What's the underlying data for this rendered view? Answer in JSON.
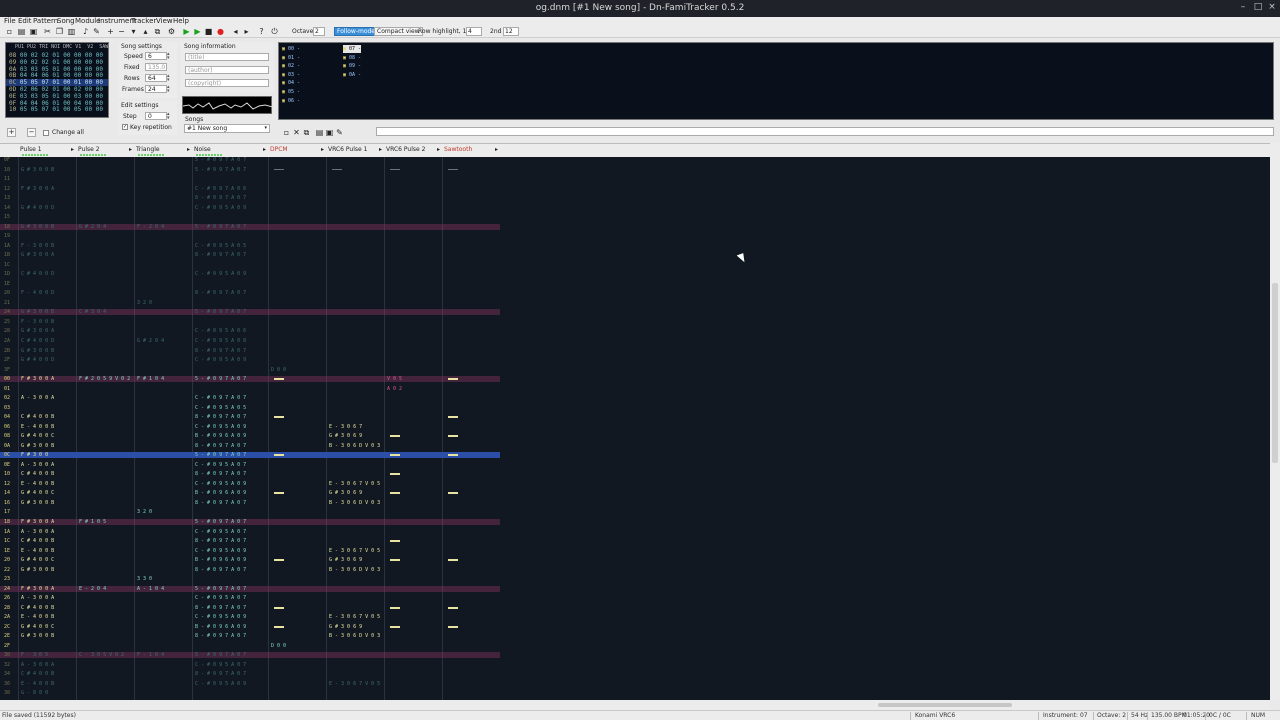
{
  "window": {
    "title": "og.dnm [#1 New song] - Dn-FamiTracker 0.5.2"
  },
  "menu": [
    "File",
    "Edit",
    "Pattern",
    "Song",
    "Module",
    "Instrument",
    "Tracker",
    "View",
    "Help"
  ],
  "toolbar": {
    "octave_label": "Octave",
    "octave_value": "2",
    "follow_mode": "Follow-mode",
    "compact_view": "Compact view",
    "row_highlight_label": "Row highlight, 1st",
    "row_highlight_1st": "4",
    "second_label": "2nd",
    "row_highlight_2nd": "12"
  },
  "frames": {
    "header": "PU1 PU2 TRI NOI DMC V1  V2  SAW",
    "rows": [
      {
        "n": "08",
        "v": "00 02 02 01 00 00 00 00"
      },
      {
        "n": "09",
        "v": "00 02 02 01 00 00 00 00"
      },
      {
        "n": "0A",
        "v": "03 03 05 01 00 00 00 00"
      },
      {
        "n": "0B",
        "v": "04 04 06 01 00 00 00 00"
      },
      {
        "n": "0C",
        "v": "05 05 07 01 00 01 00 00"
      },
      {
        "n": "0D",
        "v": "02 06 02 01 00 02 00 00"
      },
      {
        "n": "0E",
        "v": "03 03 05 01 00 03 00 00"
      },
      {
        "n": "0F",
        "v": "04 04 06 01 00 04 00 00"
      },
      {
        "n": "10",
        "v": "05 05 07 01 00 05 00 00"
      }
    ],
    "selected_index": 4,
    "change_all": "Change all"
  },
  "song_settings": {
    "title": "Song settings",
    "speed_label": "Speed",
    "speed": "6",
    "fixed_label": "Fixed",
    "fixed": "135.0",
    "rows_label": "Rows",
    "rows": "64",
    "frames_label": "Frames",
    "frames": "24"
  },
  "edit_settings": {
    "title": "Edit settings",
    "step_label": "Step",
    "step": "0",
    "key_repetition": "Key repetition"
  },
  "song_info": {
    "title": "Song information",
    "title_ph": "(title)",
    "author_ph": "(author)",
    "copyright_ph": "(copyright)",
    "songs_label": "Songs",
    "song_selected": "#1 New song"
  },
  "instruments": {
    "left": [
      "00 -",
      "01 -",
      "02 -",
      "03 -",
      "04 -",
      "05 -",
      "06 -"
    ],
    "right": [
      "07 -",
      "08 -",
      "09 -",
      "0A -"
    ],
    "selected": "07 -"
  },
  "channels": [
    {
      "name": "Pulse 1",
      "color": "#222222"
    },
    {
      "name": "Pulse 2",
      "color": "#222222"
    },
    {
      "name": "Triangle",
      "color": "#222222"
    },
    {
      "name": "Noise",
      "color": "#222222"
    },
    {
      "name": "DPCM",
      "color": "#c0392b"
    },
    {
      "name": "VRC6 Pulse 1",
      "color": "#222222"
    },
    {
      "name": "VRC6 Pulse 2",
      "color": "#222222"
    },
    {
      "name": "Sawtooth",
      "color": "#c0392b"
    }
  ],
  "pattern_rows": [
    {
      "r": "0F",
      "c": [
        "",
        "",
        "",
        "5 - # 0 9 7 A 0 7",
        "",
        "",
        "",
        ""
      ],
      "dim": true
    },
    {
      "r": "10",
      "c": [
        "G # 3 0 0 B",
        "",
        "",
        "5 - # 0 9 7 A 0 7",
        "-",
        "-",
        "-",
        "-"
      ],
      "dim": true
    },
    {
      "r": "11",
      "c": [
        "",
        "",
        "",
        "",
        "",
        "",
        "",
        ""
      ],
      "dim": true
    },
    {
      "r": "12",
      "c": [
        "F # 3 0 0 A",
        "",
        "",
        "C - # 0 9 7 A 0 6",
        "",
        "",
        "",
        ""
      ],
      "dim": true
    },
    {
      "r": "13",
      "c": [
        "",
        "",
        "",
        "8 - # 0 9 7 A 0 7",
        "",
        "",
        "",
        ""
      ],
      "dim": true
    },
    {
      "r": "14",
      "c": [
        "G # 4 0 0 D",
        "",
        "",
        "C - # 0 9 5 A 0 9",
        "",
        "",
        "",
        ""
      ],
      "dim": true
    },
    {
      "r": "15",
      "c": [
        "",
        "",
        "",
        "",
        "",
        "",
        "",
        ""
      ],
      "dim": true
    },
    {
      "r": "18",
      "c": [
        "G # 3 0 0 B",
        "G # 2 0 4",
        "F - 2 0 4",
        "5 - # 0 9 7 A 0 7",
        "",
        "",
        "",
        ""
      ],
      "dim": true,
      "hl": true
    },
    {
      "r": "19",
      "c": [
        "",
        "",
        "",
        "",
        "",
        "",
        "",
        ""
      ],
      "dim": true
    },
    {
      "r": "1A",
      "c": [
        "F - 3 0 0 B",
        "",
        "",
        "C - # 0 9 5 A 0 5",
        "",
        "",
        "",
        ""
      ],
      "dim": true
    },
    {
      "r": "1B",
      "c": [
        "G # 3 0 0 A",
        "",
        "",
        "8 - # 0 9 7 A 0 7",
        "",
        "",
        "",
        ""
      ],
      "dim": true
    },
    {
      "r": "1C",
      "c": [
        "",
        "",
        "",
        "",
        "",
        "",
        "",
        ""
      ],
      "dim": true
    },
    {
      "r": "1D",
      "c": [
        "C # 4 0 0 D",
        "",
        "",
        "C - # 0 9 5 A 0 9",
        "",
        "",
        "",
        ""
      ],
      "dim": true
    },
    {
      "r": "1E",
      "c": [
        "",
        "",
        "",
        "",
        "",
        "",
        "",
        ""
      ],
      "dim": true
    },
    {
      "r": "20",
      "c": [
        "F - 4 0 0 D",
        "",
        "",
        "8 - # 0 9 7 A 0 7",
        "",
        "",
        "",
        ""
      ],
      "dim": true
    },
    {
      "r": "21",
      "c": [
        "",
        "",
        "3 2 0",
        "",
        "",
        "",
        "",
        ""
      ],
      "dim": true
    },
    {
      "r": "24",
      "c": [
        "G # 3 0 0 B",
        "C # 3 0 4",
        "",
        "5 - # 0 9 7 A 0 7",
        "",
        "",
        "",
        ""
      ],
      "dim": true,
      "hl": true
    },
    {
      "r": "25",
      "c": [
        "F - 3 0 0 B",
        "",
        "",
        "",
        "",
        "",
        "",
        ""
      ],
      "dim": true
    },
    {
      "r": "28",
      "c": [
        "G # 3 0 0 A",
        "",
        "",
        "C - # 0 9 5 A 0 6",
        "",
        "",
        "",
        ""
      ],
      "dim": true
    },
    {
      "r": "2A",
      "c": [
        "C # 4 0 0 D",
        "",
        "G # 2 0 4",
        "C - # 0 9 5 A 0 8",
        "",
        "",
        "",
        ""
      ],
      "dim": true
    },
    {
      "r": "2B",
      "c": [
        "G # 3 0 0 B",
        "",
        "",
        "8 - # 0 9 7 A 0 7",
        "",
        "",
        "",
        ""
      ],
      "dim": true
    },
    {
      "r": "2F",
      "c": [
        "G # 4 0 0 D",
        "",
        "",
        "C - # 0 9 5 A 0 9",
        "",
        "",
        "",
        ""
      ],
      "dim": true
    },
    {
      "r": "3F",
      "c": [
        "",
        "",
        "",
        "",
        "D 0 0",
        "",
        "",
        ""
      ],
      "dim": true
    },
    {
      "r": "00",
      "c": [
        "F # 3 0 0 A",
        "F # 2 0 5 9 V 0 2",
        "F # 1 0 4",
        "5 - # 0 9 7 A 0 7",
        "-",
        "",
        "V 0 5",
        "-"
      ],
      "hl": true
    },
    {
      "r": "01",
      "c": [
        "",
        "",
        "",
        "",
        "",
        "",
        "A 0 2",
        ""
      ]
    },
    {
      "r": "02",
      "c": [
        "A - 3 0 0 A",
        "",
        "",
        "C - # 0 9 7 A 0 7",
        "",
        "",
        "",
        ""
      ]
    },
    {
      "r": "03",
      "c": [
        "",
        "",
        "",
        "C - # 0 9 5 A 0 5",
        "",
        "",
        "",
        ""
      ]
    },
    {
      "r": "04",
      "c": [
        "C # 4 0 0 B",
        "",
        "",
        "8 - # 0 9 7 A 0 7",
        "-",
        "",
        "",
        "-"
      ]
    },
    {
      "r": "06",
      "c": [
        "E - 4 0 0 B",
        "",
        "",
        "C - # 0 9 5 A 0 9",
        "",
        "E - 3 0 6 7",
        "",
        ""
      ]
    },
    {
      "r": "08",
      "c": [
        "G # 4 0 0 C",
        "",
        "",
        "B - # 0 9 6 A 0 9",
        "",
        "G # 3 0 6 9",
        "-",
        "-"
      ]
    },
    {
      "r": "0A",
      "c": [
        "G # 3 0 0 B",
        "",
        "",
        "8 - # 0 9 7 A 0 7",
        "",
        "B - 3 0 6 D V 0 3",
        "",
        ""
      ]
    },
    {
      "r": "0C",
      "c": [
        "F # 3 0 0",
        "",
        "",
        "5 - # 0 9 7 A 0 7",
        "-",
        "",
        "-",
        "-"
      ],
      "cur": true
    },
    {
      "r": "0E",
      "c": [
        "A - 3 0 0 A",
        "",
        "",
        "C - # 0 9 5 A 0 7",
        "",
        "",
        "",
        ""
      ]
    },
    {
      "r": "10",
      "c": [
        "C # 4 0 0 B",
        "",
        "",
        "8 - # 0 9 7 A 0 7",
        "",
        "",
        "-",
        ""
      ]
    },
    {
      "r": "12",
      "c": [
        "E - 4 0 0 B",
        "",
        "",
        "C - # 0 9 5 A 0 9",
        "",
        "E - 3 0 6 7 V 0 5",
        "",
        ""
      ]
    },
    {
      "r": "14",
      "c": [
        "G # 4 0 0 C",
        "",
        "",
        "B - # 0 9 6 A 0 9",
        "-",
        "G # 3 0 6 9",
        "-",
        "-"
      ]
    },
    {
      "r": "16",
      "c": [
        "G # 3 0 0 B",
        "",
        "",
        "8 - # 0 9 7 A 0 7",
        "",
        "B - 3 0 6 D V 0 3",
        "",
        ""
      ]
    },
    {
      "r": "17",
      "c": [
        "",
        "",
        "3 2 0",
        "",
        "",
        "",
        "",
        ""
      ]
    },
    {
      "r": "18",
      "c": [
        "F # 3 0 0 A",
        "F # 1 0 5",
        "",
        "5 - # 0 9 7 A 0 7",
        "",
        "",
        "",
        ""
      ],
      "hl": true
    },
    {
      "r": "1A",
      "c": [
        "A - 3 0 0 A",
        "",
        "",
        "C - # 0 9 5 A 0 7",
        "",
        "",
        "",
        ""
      ]
    },
    {
      "r": "1C",
      "c": [
        "C # 4 0 0 B",
        "",
        "",
        "8 - # 0 9 7 A 0 7",
        "",
        "",
        "-",
        ""
      ]
    },
    {
      "r": "1E",
      "c": [
        "E - 4 0 0 B",
        "",
        "",
        "C - # 0 9 5 A 0 9",
        "",
        "E - 3 0 6 7 V 0 5",
        "",
        ""
      ]
    },
    {
      "r": "20",
      "c": [
        "G # 4 0 0 C",
        "",
        "",
        "B - # 0 9 6 A 0 9",
        "-",
        "G # 3 0 6 9",
        "-",
        "-"
      ]
    },
    {
      "r": "22",
      "c": [
        "G # 3 0 0 B",
        "",
        "",
        "8 - # 0 9 7 A 0 7",
        "",
        "B - 3 0 6 D V 0 3",
        "",
        ""
      ]
    },
    {
      "r": "23",
      "c": [
        "",
        "",
        "3 3 0",
        "",
        "",
        "",
        "",
        ""
      ]
    },
    {
      "r": "24",
      "c": [
        "F # 3 0 0 A",
        "E - 2 0 4",
        "A - 1 0 4",
        "5 - # 0 9 7 A 0 7",
        "",
        "",
        "",
        ""
      ],
      "hl": true
    },
    {
      "r": "26",
      "c": [
        "A - 3 0 0 A",
        "",
        "",
        "C - # 0 9 5 A 0 7",
        "",
        "",
        "",
        ""
      ]
    },
    {
      "r": "28",
      "c": [
        "C # 4 0 0 B",
        "",
        "",
        "8 - # 0 9 7 A 0 7",
        "-",
        "",
        "-",
        "-"
      ]
    },
    {
      "r": "2A",
      "c": [
        "E - 4 0 0 B",
        "",
        "",
        "C - # 0 9 5 A 0 9",
        "",
        "E - 3 0 6 7 V 0 5",
        "",
        ""
      ]
    },
    {
      "r": "2C",
      "c": [
        "G # 4 0 0 C",
        "",
        "",
        "B - # 0 9 6 A 0 9",
        "-",
        "G # 3 0 6 9",
        "-",
        "-"
      ]
    },
    {
      "r": "2E",
      "c": [
        "G # 3 0 0 B",
        "",
        "",
        "8 - # 0 9 7 A 0 7",
        "",
        "B - 3 0 6 D V 0 3",
        "",
        ""
      ]
    },
    {
      "r": "2F",
      "c": [
        "",
        "",
        "",
        "",
        "D 0 0",
        "",
        "",
        ""
      ]
    },
    {
      "r": "30",
      "c": [
        "F - 3 0 5",
        "C - 3 0 5 V 0 2",
        "F - 1 0 4",
        "5 - # 0 9 7 A 0 7",
        "",
        "",
        "",
        ""
      ],
      "dim": true,
      "hl": true
    },
    {
      "r": "32",
      "c": [
        "A - 3 0 0 A",
        "",
        "",
        "C - # 0 9 5 A 0 7",
        "",
        "",
        "",
        ""
      ],
      "dim": true
    },
    {
      "r": "34",
      "c": [
        "C # 4 0 0 B",
        "",
        "",
        "8 - # 0 9 7 A 0 7",
        "",
        "",
        "",
        ""
      ],
      "dim": true
    },
    {
      "r": "36",
      "c": [
        "E - 4 0 0 B",
        "",
        "",
        "C - # 0 9 5 A 0 9",
        "",
        "E - 3 0 6 7 V 0 5",
        "",
        ""
      ],
      "dim": true
    },
    {
      "r": "38",
      "c": [
        "G - 8 0 0",
        "",
        "",
        "",
        "",
        "",
        "",
        ""
      ],
      "dim": true
    }
  ],
  "status": {
    "left": "File saved (11592 bytes)",
    "chip": "Konami VRC6",
    "instrument": "Instrument: 07",
    "octave": "Octave: 2",
    "rate": "54 Hz",
    "tempo": "135.00 BPM",
    "time": "01:05:20",
    "pos": "0C / 0C",
    "num": "NUM"
  }
}
